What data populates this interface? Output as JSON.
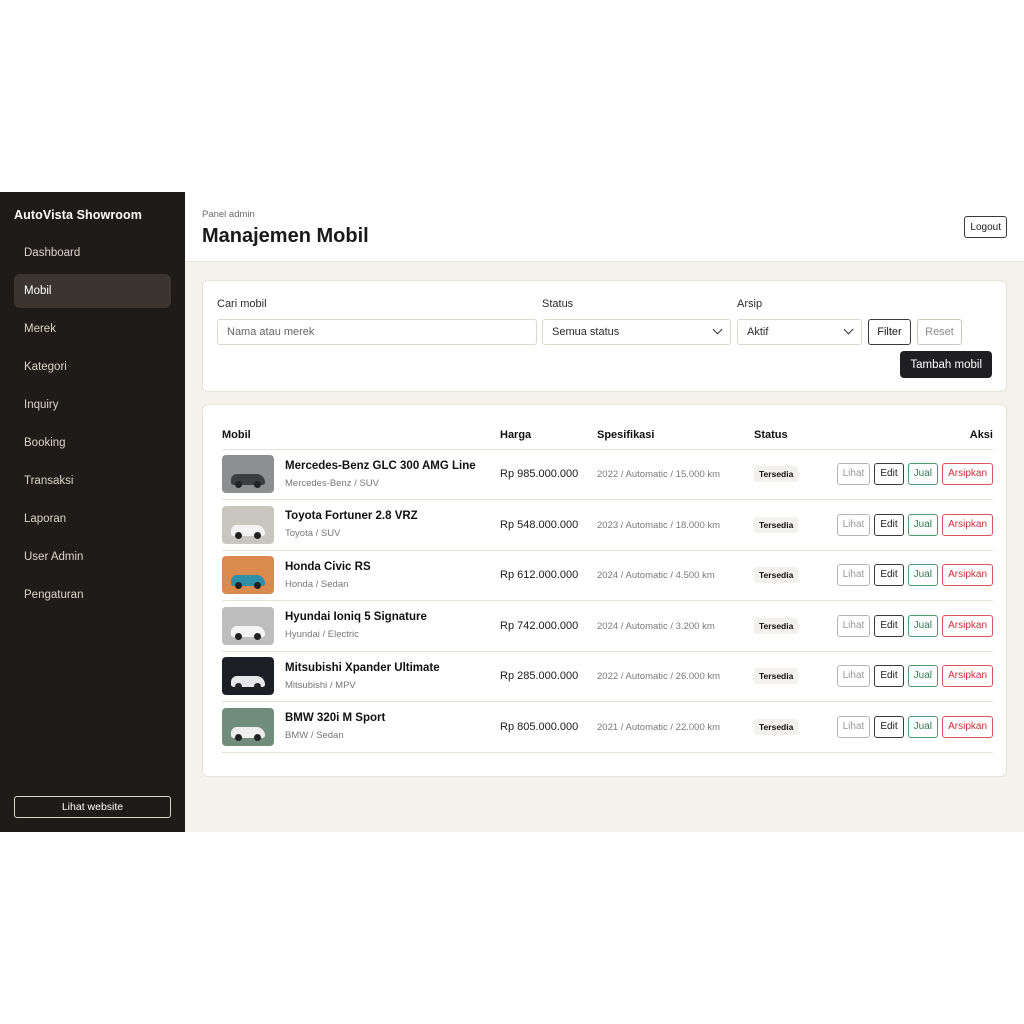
{
  "sidebar": {
    "brand": "AutoVista Showroom",
    "items": [
      {
        "label": "Dashboard"
      },
      {
        "label": "Mobil",
        "active": true
      },
      {
        "label": "Merek"
      },
      {
        "label": "Kategori"
      },
      {
        "label": "Inquiry"
      },
      {
        "label": "Booking"
      },
      {
        "label": "Transaksi"
      },
      {
        "label": "Laporan"
      },
      {
        "label": "User Admin"
      },
      {
        "label": "Pengaturan"
      }
    ],
    "website_button": "Lihat website"
  },
  "header": {
    "breadcrumb": "Panel admin",
    "title": "Manajemen Mobil",
    "logout_label": "Logout"
  },
  "filters": {
    "search_label": "Cari mobil",
    "search_placeholder": "Nama atau merek",
    "status_label": "Status",
    "status_value": "Semua status",
    "archive_label": "Arsip",
    "archive_value": "Aktif",
    "filter_button": "Filter",
    "reset_button": "Reset",
    "add_button": "Tambah mobil"
  },
  "table": {
    "headers": {
      "car": "Mobil",
      "price": "Harga",
      "spec": "Spesifikasi",
      "status": "Status",
      "actions": "Aksi"
    },
    "action_labels": {
      "view": "Lihat",
      "edit": "Edit",
      "sell": "Jual",
      "archive": "Arsipkan"
    },
    "rows": [
      {
        "name": "Mercedes-Benz GLC 300 AMG Line",
        "sub": "Mercedes-Benz / SUV",
        "price": "Rp 985.000.000",
        "spec": "2022 / Automatic / 15.000 km",
        "status": "Tersedia",
        "thumb_bg": "#8d8f91",
        "car_color": "#3b3d40"
      },
      {
        "name": "Toyota Fortuner 2.8 VRZ",
        "sub": "Toyota / SUV",
        "price": "Rp 548.000.000",
        "spec": "2023 / Automatic / 18.000 km",
        "status": "Tersedia",
        "thumb_bg": "#c9c6c0",
        "car_color": "#f2f2f2"
      },
      {
        "name": "Honda Civic RS",
        "sub": "Honda / Sedan",
        "price": "Rp 612.000.000",
        "spec": "2024 / Automatic / 4.500 km",
        "status": "Tersedia",
        "thumb_bg": "#d98a4e",
        "car_color": "#2f8fa8"
      },
      {
        "name": "Hyundai Ioniq 5 Signature",
        "sub": "Hyundai / Electric",
        "price": "Rp 742.000.000",
        "spec": "2024 / Automatic / 3.200 km",
        "status": "Tersedia",
        "thumb_bg": "#bdbdbd",
        "car_color": "#f5f5f5"
      },
      {
        "name": "Mitsubishi Xpander Ultimate",
        "sub": "Mitsubishi / MPV",
        "price": "Rp 285.000.000",
        "spec": "2022 / Automatic / 26.000 km",
        "status": "Tersedia",
        "thumb_bg": "#1c2026",
        "car_color": "#e8e8ea"
      },
      {
        "name": "BMW 320i M Sport",
        "sub": "BMW / Sedan",
        "price": "Rp 805.000.000",
        "spec": "2021 / Automatic / 22.000 km",
        "status": "Tersedia",
        "thumb_bg": "#6f8c7d",
        "car_color": "#eeeeee"
      }
    ]
  }
}
